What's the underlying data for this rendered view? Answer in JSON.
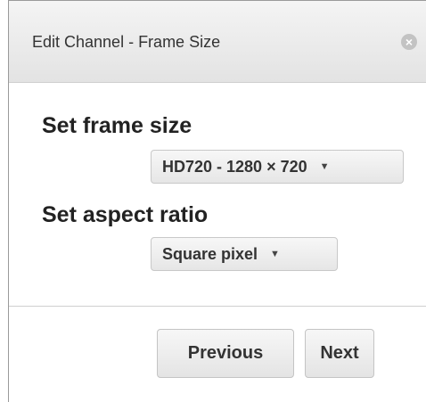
{
  "dialog": {
    "title": "Edit Channel - Frame Size",
    "close_icon": "close-icon"
  },
  "frame_size": {
    "label": "Set frame size",
    "selected": "HD720 - 1280 × 720"
  },
  "aspect_ratio": {
    "label": "Set aspect ratio",
    "selected": "Square pixel"
  },
  "footer": {
    "previous_label": "Previous",
    "next_label": "Next"
  },
  "colors": {
    "titlebar_bg": "#e9e9e9",
    "text": "#333333",
    "close_icon": "#c3c3c3"
  }
}
